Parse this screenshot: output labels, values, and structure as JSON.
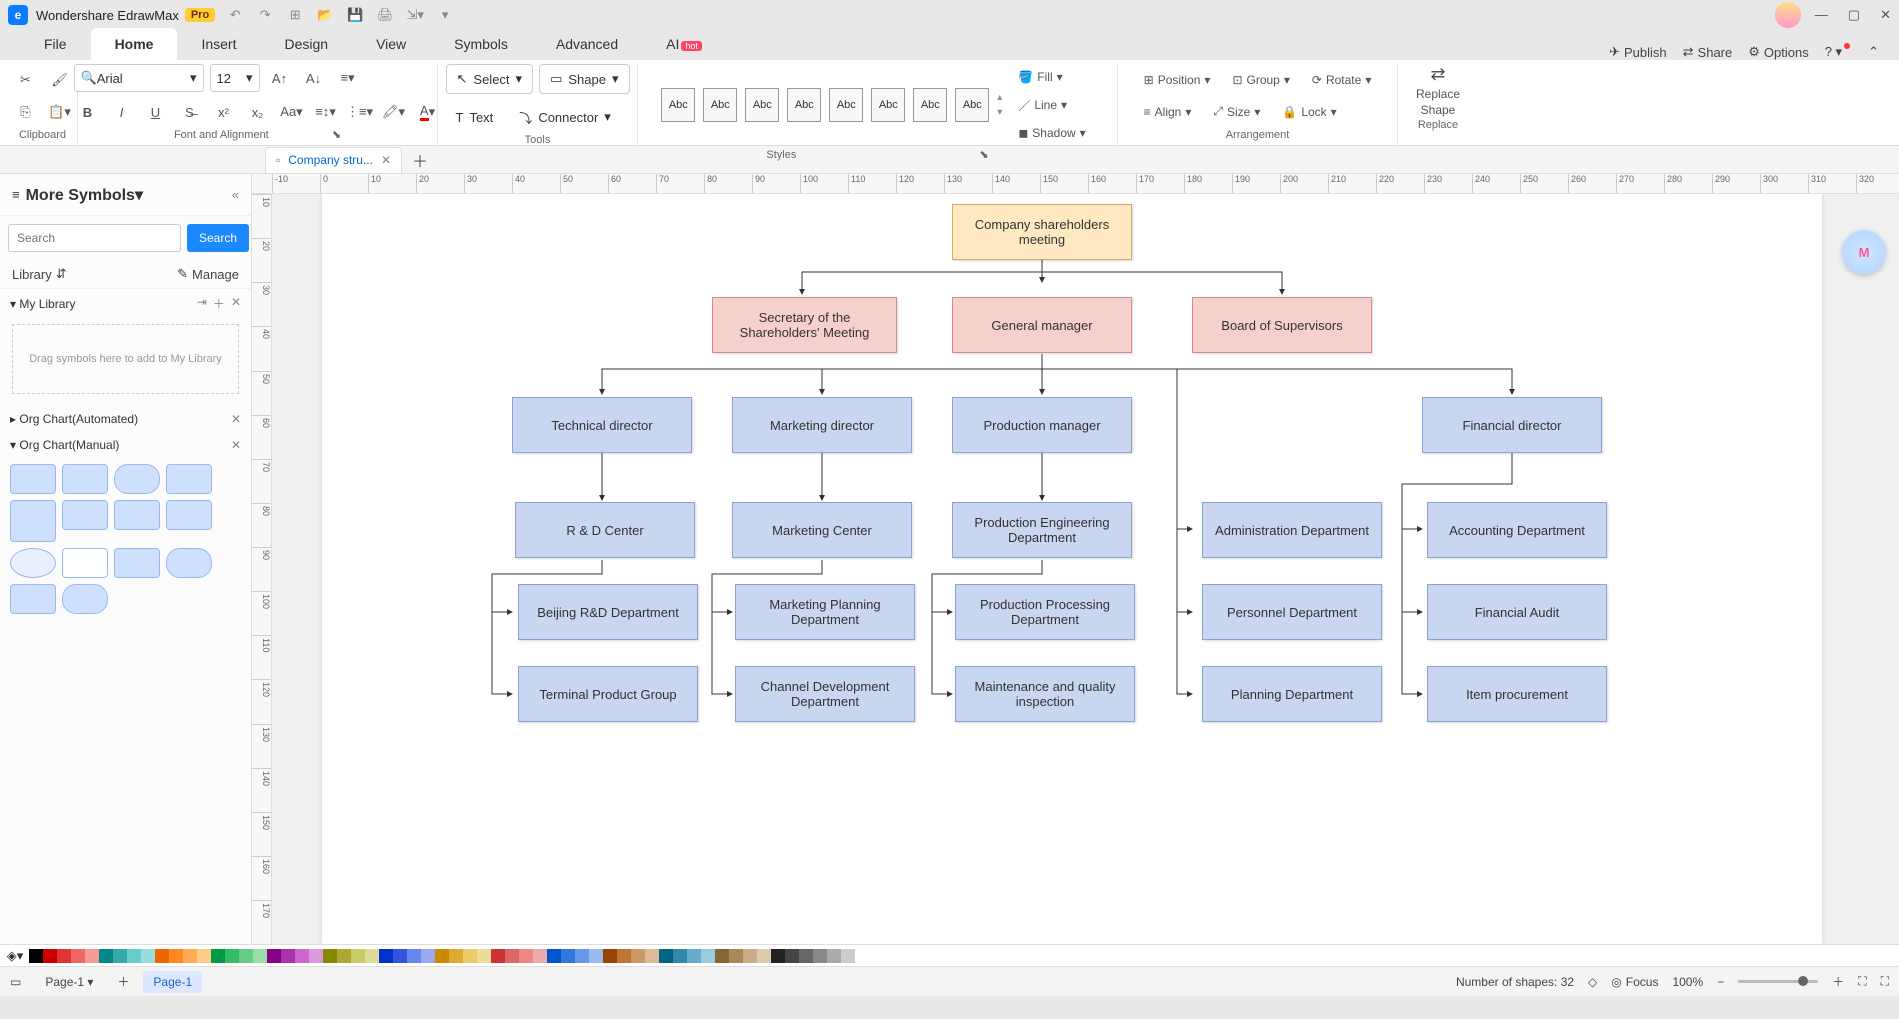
{
  "title_bar": {
    "app_name": "Wondershare EdrawMax",
    "pro": "Pro"
  },
  "menu": {
    "file": "File",
    "home": "Home",
    "insert": "Insert",
    "design": "Design",
    "view": "View",
    "symbols": "Symbols",
    "advanced": "Advanced",
    "ai": "AI",
    "ai_badge": "hot",
    "publish": "Publish",
    "share": "Share",
    "options": "Options"
  },
  "ribbon": {
    "clipboard": "Clipboard",
    "font_alignment": "Font and Alignment",
    "font_name": "Arial",
    "font_size": "12",
    "tools": "Tools",
    "select": "Select",
    "shape": "Shape",
    "text": "Text",
    "connector": "Connector",
    "styles": "Styles",
    "style_label": "Abc",
    "fill": "Fill",
    "line": "Line",
    "shadow": "Shadow",
    "arrangement": "Arrangement",
    "position": "Position",
    "align": "Align",
    "group": "Group",
    "size": "Size",
    "rotate": "Rotate",
    "lock": "Lock",
    "replace": "Replace",
    "replace_label1": "Replace",
    "replace_label2": "Shape"
  },
  "tabs": {
    "doc_name": "Company stru...",
    "page_active": "Page-1"
  },
  "sidebar": {
    "title": "More Symbols",
    "search_placeholder": "Search",
    "search_btn": "Search",
    "library": "Library",
    "manage": "Manage",
    "my_library": "My Library",
    "drop_hint": "Drag symbols here to add to My Library",
    "org_auto": "Org Chart(Automated)",
    "org_manual": "Org Chart(Manual)"
  },
  "rulers_h": [
    "-10",
    "0",
    "10",
    "20",
    "30",
    "40",
    "50",
    "60",
    "70",
    "80",
    "90",
    "100",
    "110",
    "120",
    "130",
    "140",
    "150",
    "160",
    "170",
    "180",
    "190",
    "200",
    "210",
    "220",
    "230",
    "240",
    "250",
    "260",
    "270",
    "280",
    "290",
    "300",
    "310",
    "320"
  ],
  "rulers_v": [
    "10",
    "20",
    "30",
    "40",
    "50",
    "60",
    "70",
    "80",
    "90",
    "100",
    "110",
    "120",
    "130",
    "140",
    "150",
    "160",
    "170"
  ],
  "chart_data": {
    "type": "org-chart",
    "nodes": [
      {
        "id": "shareholders",
        "label": "Company shareholders meeting",
        "level": 1
      },
      {
        "id": "secretary",
        "label": "Secretary of the Shareholders' Meeting",
        "level": 2,
        "parent": "shareholders"
      },
      {
        "id": "gm",
        "label": "General manager",
        "level": 2,
        "parent": "shareholders"
      },
      {
        "id": "supervisors",
        "label": "Board of Supervisors",
        "level": 2,
        "parent": "shareholders"
      },
      {
        "id": "tech_dir",
        "label": "Technical director",
        "level": 3,
        "parent": "gm"
      },
      {
        "id": "mkt_dir",
        "label": "Marketing director",
        "level": 3,
        "parent": "gm"
      },
      {
        "id": "prod_mgr",
        "label": "Production manager",
        "level": 3,
        "parent": "gm"
      },
      {
        "id": "fin_dir",
        "label": "Financial director",
        "level": 3,
        "parent": "gm"
      },
      {
        "id": "rd_center",
        "label": "R & D Center",
        "level": 4,
        "parent": "tech_dir"
      },
      {
        "id": "mkt_center",
        "label": "Marketing Center",
        "level": 4,
        "parent": "mkt_dir"
      },
      {
        "id": "prod_eng",
        "label": "Production Engineering Department",
        "level": 4,
        "parent": "prod_mgr"
      },
      {
        "id": "admin",
        "label": "Administration Department",
        "level": 4,
        "parent": "gm"
      },
      {
        "id": "acct",
        "label": "Accounting Department",
        "level": 4,
        "parent": "fin_dir"
      },
      {
        "id": "beijing_rd",
        "label": "Beijing R&D Department",
        "level": 5,
        "parent": "rd_center"
      },
      {
        "id": "terminal",
        "label": "Terminal Product Group",
        "level": 5,
        "parent": "rd_center"
      },
      {
        "id": "mkt_plan",
        "label": "Marketing Planning Department",
        "level": 5,
        "parent": "mkt_center"
      },
      {
        "id": "channel",
        "label": "Channel Development Department",
        "level": 5,
        "parent": "mkt_center"
      },
      {
        "id": "prod_proc",
        "label": "Production Processing Department",
        "level": 5,
        "parent": "prod_mgr"
      },
      {
        "id": "maint",
        "label": "Maintenance and quality inspection",
        "level": 5,
        "parent": "prod_mgr"
      },
      {
        "id": "personnel",
        "label": "Personnel Department",
        "level": 5,
        "parent": "gm"
      },
      {
        "id": "planning",
        "label": "Planning Department",
        "level": 5,
        "parent": "gm"
      },
      {
        "id": "fin_audit",
        "label": "Financial Audit",
        "level": 5,
        "parent": "fin_dir"
      },
      {
        "id": "item_proc",
        "label": "Item procurement",
        "level": 5,
        "parent": "fin_dir"
      }
    ]
  },
  "colors": [
    "#000000",
    "#cc0000",
    "#e03333",
    "#ee6666",
    "#f59999",
    "#008888",
    "#33aaaa",
    "#66cccc",
    "#99dddd",
    "#ee6600",
    "#ff8822",
    "#ffaa55",
    "#ffcc88",
    "#009944",
    "#33bb66",
    "#66cc88",
    "#99ddaa",
    "#880088",
    "#aa33aa",
    "#cc66cc",
    "#dd99dd",
    "#888800",
    "#aaaa33",
    "#cccc66",
    "#dddd99",
    "#0033cc",
    "#3355dd",
    "#6688ee",
    "#99aaee",
    "#cc8800",
    "#ddaa33",
    "#eecc66",
    "#eedd99",
    "#cc3333",
    "#dd6666",
    "#ee8888",
    "#eeaaaa",
    "#0055cc",
    "#3377dd",
    "#6699ee",
    "#99bbee",
    "#994400",
    "#bb7733",
    "#cc9966",
    "#ddbb99",
    "#006688",
    "#3388aa",
    "#66aacc",
    "#99ccdd",
    "#886633",
    "#aa8855",
    "#ccaa88",
    "#ddccaa",
    "#222222",
    "#444444",
    "#666666",
    "#888888",
    "#aaaaaa",
    "#cccccc"
  ],
  "status": {
    "page_select": "Page-1",
    "shapes": "Number of shapes: 32",
    "focus": "Focus",
    "zoom": "100%"
  }
}
